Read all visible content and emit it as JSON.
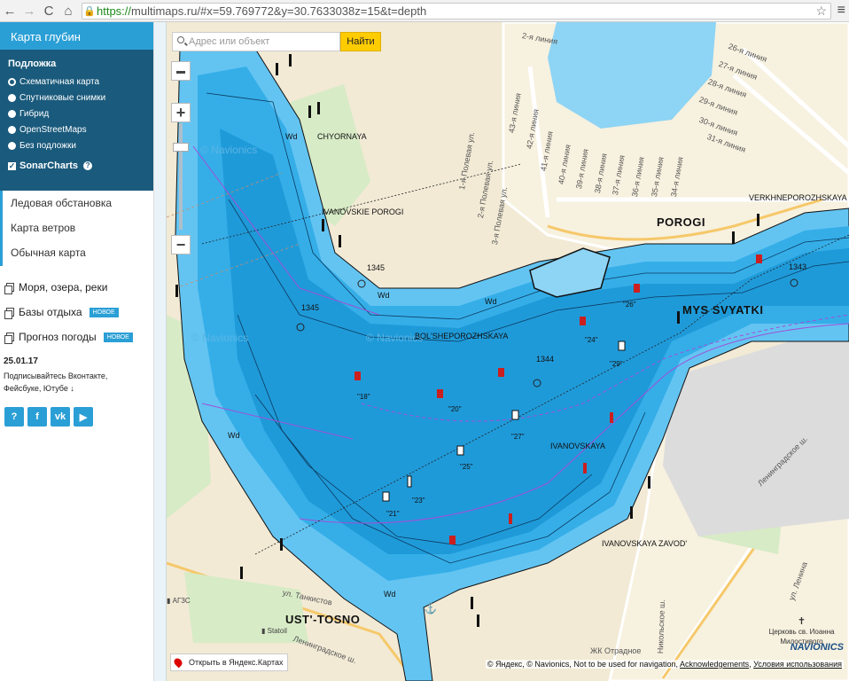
{
  "browser": {
    "url_scheme": "https://",
    "url_rest": "multimaps.ru/#x=59.769772&y=30.7633038z=15&t=depth"
  },
  "sidebar": {
    "header": "Карта глубин",
    "basemap_title": "Подложка",
    "basemap_options": [
      "Схематичная карта",
      "Спутниковые снимки",
      "Гибрид",
      "OpenStreetMaps",
      "Без подложки"
    ],
    "selected_basemap": "Схематичная карта",
    "sonar_label": "SonarCharts",
    "sonar_checked": true,
    "links": [
      "Ледовая обстановка",
      "Карта ветров",
      "Обычная карта"
    ],
    "categories": [
      {
        "label": "Моря, озера, реки",
        "badge": ""
      },
      {
        "label": "Базы отдыха",
        "badge": "НОВОЕ"
      },
      {
        "label": "Прогноз погоды",
        "badge": "НОВОЕ"
      }
    ],
    "news_date": "25.01.17",
    "news_text": "Подписывайтесь Вконтакте, Фейсбуке, Ютубе",
    "social": [
      "?",
      "f",
      "vk",
      "▶"
    ]
  },
  "map": {
    "search_placeholder": "Адрес или объект",
    "search_button": "Найти",
    "places": {
      "chyornaya": "CHYORNAYA",
      "ivanovskie": "IVANOVSKIE POROGI",
      "porogi": "POROGI",
      "verkhneporozhskaya": "VERKHNEPOROZHSKAYA",
      "mys": "MYS SVYATKI",
      "bolsheporozhskaya": "BOL'SHEPOROZHSKAYA",
      "ivanovskaya": "IVANOVSKAYA",
      "ivanovskaya_zavod": "IVANOVSKAYA ZAVOD'",
      "ust_tosno": "UST'-TOSNO"
    },
    "depths": [
      "1345",
      "1345",
      "1344",
      "1343",
      "Wd",
      "Wd",
      "Wd",
      "Wd",
      "Wd"
    ],
    "buoy_labels": [
      "\"26\"",
      "\"24\"",
      "\"29\"",
      "\"18\"",
      "\"20\"",
      "\"27\"",
      "\"25\"",
      "\"23\"",
      "\"21\""
    ],
    "streets": {
      "liniya2": "2-я линия",
      "liniya26": "26-я линия",
      "liniya27": "27-я линия",
      "liniya28": "28-я линия",
      "liniya29": "29-я линия",
      "liniya30": "30-я линия",
      "liniya31": "31-я линия",
      "liniya43": "43-я линия",
      "liniya42": "42-я линия",
      "liniya41": "41-я линия",
      "liniya40": "40-я линия",
      "liniya39": "39-я линия",
      "liniya38": "38-я линия",
      "liniya37": "37-я линия",
      "liniya36": "36-я линия",
      "liniya35": "35-я линия",
      "liniya34": "34-я линия",
      "polevaya1": "1-я Полевая ул.",
      "polevaya2": "2-я Полевая ул.",
      "polevaya3": "3-я Полевая ул.",
      "leningradskoe1": "Ленинградское ш.",
      "leningradskoe2": "Ленинградское ш.",
      "tankistov": "ул. Танкистов",
      "nikolskoe": "Никольское ш.",
      "lenina": "ул. Ленина",
      "otradnoe": "ЖК Отрадное"
    },
    "pois": {
      "church": "Церковь св. Иоанна Милостивого",
      "statoil": "Statoil",
      "azs": "АГЗС"
    },
    "open_yandex": "Открыть в Яндекс.Картах",
    "copyright_main": "© Яндекс, © Navionics, Not to be used for navigation,",
    "copyright_ack": "Acknowledgements",
    "copyright_terms": "Условия использования",
    "navionics_logo": "NAVIONICS",
    "watermarks": [
      "© Navionics",
      "© Navionics",
      "© Navionics"
    ]
  },
  "colors": {
    "water_deep": "#1f9ad9",
    "water_shallow": "#63c4f2",
    "land": "#f2ead5",
    "accent": "#2a9fd6",
    "sidebar_dark": "#1a5a7c"
  }
}
